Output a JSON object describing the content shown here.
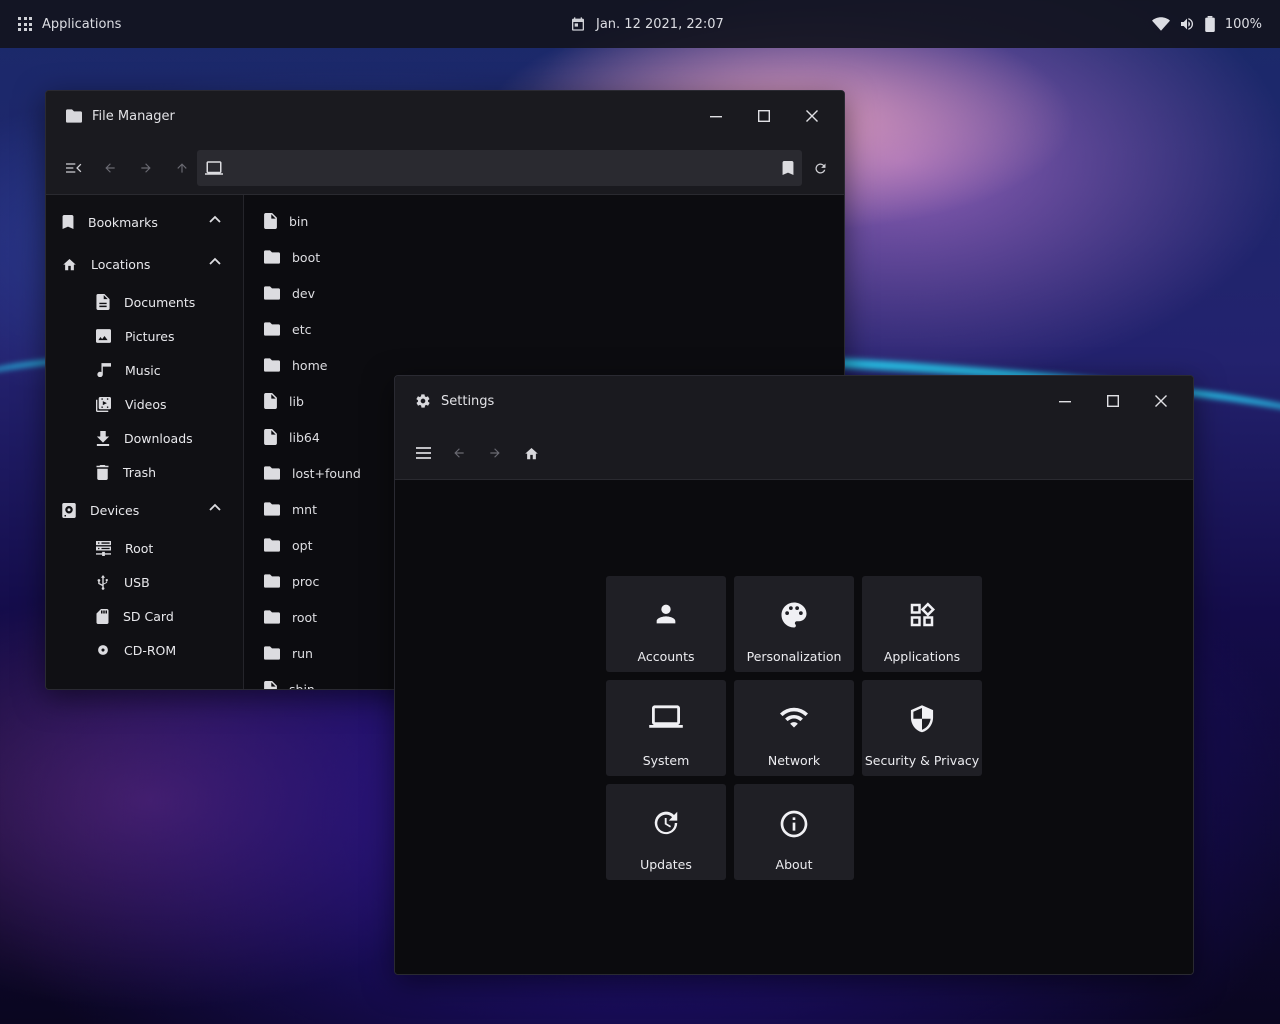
{
  "topbar": {
    "apps_label": "Applications",
    "datetime": "Jan. 12 2021, 22:07",
    "battery": "100%"
  },
  "file_manager": {
    "title": "File Manager",
    "sidebar": {
      "bookmarks_label": "Bookmarks",
      "locations_label": "Locations",
      "locations": [
        {
          "label": "Documents",
          "icon": "document-icon"
        },
        {
          "label": "Pictures",
          "icon": "image-icon"
        },
        {
          "label": "Music",
          "icon": "music-note-icon"
        },
        {
          "label": "Videos",
          "icon": "video-icon"
        },
        {
          "label": "Downloads",
          "icon": "download-icon"
        },
        {
          "label": "Trash",
          "icon": "trash-icon"
        }
      ],
      "devices_label": "Devices",
      "devices": [
        {
          "label": "Root",
          "icon": "server-icon"
        },
        {
          "label": "USB",
          "icon": "usb-icon"
        },
        {
          "label": "SD Card",
          "icon": "sd-card-icon"
        },
        {
          "label": "CD-ROM",
          "icon": "disc-icon"
        }
      ]
    },
    "files": [
      {
        "name": "bin",
        "type": "file"
      },
      {
        "name": "boot",
        "type": "folder"
      },
      {
        "name": "dev",
        "type": "folder"
      },
      {
        "name": "etc",
        "type": "folder"
      },
      {
        "name": "home",
        "type": "folder"
      },
      {
        "name": "lib",
        "type": "file"
      },
      {
        "name": "lib64",
        "type": "file"
      },
      {
        "name": "lost+found",
        "type": "folder"
      },
      {
        "name": "mnt",
        "type": "folder"
      },
      {
        "name": "opt",
        "type": "folder"
      },
      {
        "name": "proc",
        "type": "folder"
      },
      {
        "name": "root",
        "type": "folder"
      },
      {
        "name": "run",
        "type": "folder"
      },
      {
        "name": "sbin",
        "type": "file"
      }
    ]
  },
  "settings": {
    "title": "Settings",
    "tiles": [
      {
        "label": "Accounts",
        "icon": "account-icon"
      },
      {
        "label": "Personalization",
        "icon": "palette-icon"
      },
      {
        "label": "Applications",
        "icon": "apps-icon"
      },
      {
        "label": "System",
        "icon": "laptop-icon"
      },
      {
        "label": "Network",
        "icon": "wifi-icon"
      },
      {
        "label": "Security & Privacy",
        "icon": "shield-icon"
      },
      {
        "label": "Updates",
        "icon": "update-icon"
      },
      {
        "label": "About",
        "icon": "info-icon"
      }
    ]
  },
  "colors": {
    "window_bg": "#0c0c10",
    "titlebar_bg": "#1a1a1f",
    "tile_bg": "#1f1f25",
    "accent_cyan": "#28dcff"
  }
}
